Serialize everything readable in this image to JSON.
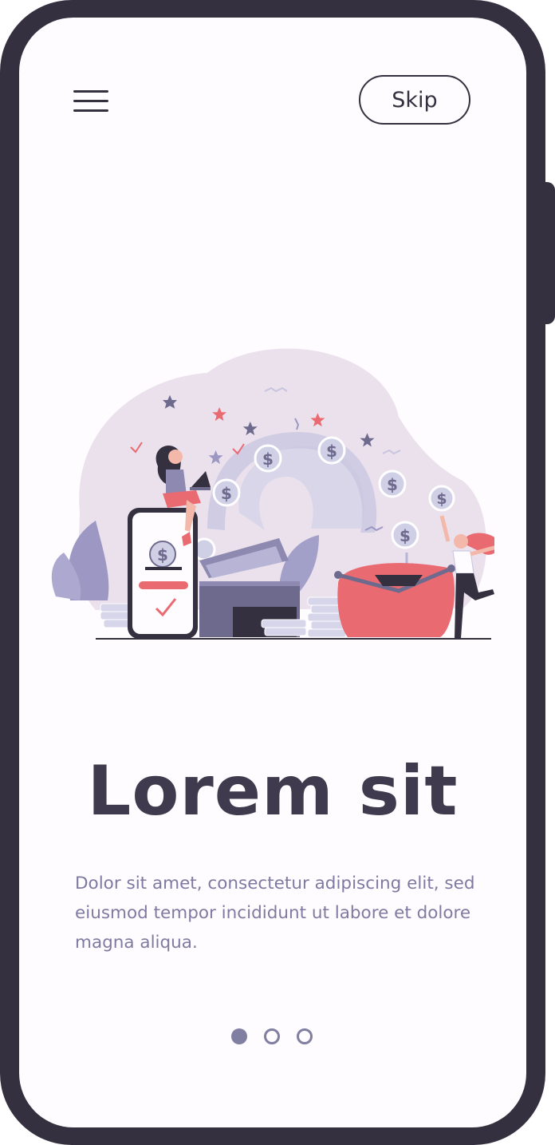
{
  "header": {
    "menu_icon": "hamburger-menu-icon",
    "skip_label": "Skip"
  },
  "illustration": {
    "subject": "woman with laptop on phone, coins flying into a red purse, woman catching coin",
    "coin_symbol": "$"
  },
  "content": {
    "title": "Lorem sit",
    "body": "Dolor sit amet, consectetur adipiscing elit, sed eiusmod tempor incididunt ut labore et dolore magna aliqua."
  },
  "pagination": {
    "total": 3,
    "current": 1
  },
  "colors": {
    "frame": "#34303f",
    "screen": "#fefcfe",
    "title": "#3f3a4d",
    "body": "#7f7aa1",
    "dot": "#807ea1",
    "accent_red": "#ea6a72",
    "blob": "#ebe1ed",
    "coin": "#cfcfe6"
  }
}
